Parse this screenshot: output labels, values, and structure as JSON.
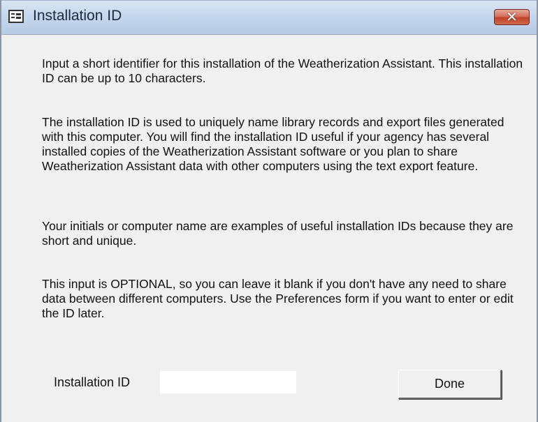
{
  "window": {
    "title": "Installation ID",
    "close_symbol": "✕",
    "icon": "form-icon"
  },
  "content": {
    "paragraph_1": "Input a short identifier for this installation of the Weatherization Assistant.  This installation ID can be up to 10 characters.",
    "paragraph_2": "The installation ID is used to uniquely name library records and export files generated with this computer.  You will find the installation ID useful if your agency has several installed copies of the Weatherization Assistant software or you plan to share Weatherization Assistant data with other computers using the text export feature.",
    "paragraph_3": "Your initials or computer name are examples of useful installation IDs because they are short and unique.",
    "paragraph_4": "This input is OPTIONAL, so you can leave it blank if you don't have any need to share data between different computers. Use the Preferences form if you want to enter or edit the ID later."
  },
  "form": {
    "installation_id_label": "Installation ID",
    "installation_id_value": "",
    "done_label": "Done"
  },
  "colors": {
    "dialog_background": "#f0f0f0",
    "titlebar": "#c4d6ec",
    "close_button": "#c0412b"
  }
}
